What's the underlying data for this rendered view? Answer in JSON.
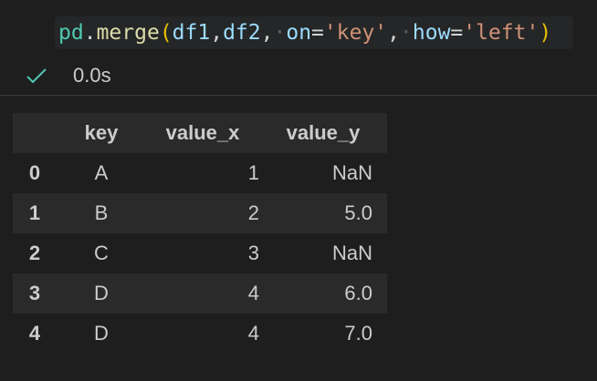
{
  "code": {
    "tokens": [
      {
        "t": "pd",
        "c": "tok-var"
      },
      {
        "t": ".",
        "c": "tok-op"
      },
      {
        "t": "merge",
        "c": "tok-fn"
      },
      {
        "t": "(",
        "c": "tok-paren"
      },
      {
        "t": "df1",
        "c": "tok-param"
      },
      {
        "t": ",",
        "c": "tok-op"
      },
      {
        "t": "df2",
        "c": "tok-param"
      },
      {
        "t": ",",
        "c": "tok-op"
      },
      {
        "t": "·",
        "c": "tok-ws"
      },
      {
        "t": "on",
        "c": "tok-param"
      },
      {
        "t": "=",
        "c": "tok-op"
      },
      {
        "t": "'key'",
        "c": "tok-str"
      },
      {
        "t": ",",
        "c": "tok-op"
      },
      {
        "t": "·",
        "c": "tok-ws"
      },
      {
        "t": "how",
        "c": "tok-param"
      },
      {
        "t": "=",
        "c": "tok-op"
      },
      {
        "t": "'left'",
        "c": "tok-str"
      },
      {
        "t": ")",
        "c": "tok-paren"
      }
    ]
  },
  "status": {
    "icon": "check-icon",
    "time": "0.0s",
    "color": "#4ec9b0"
  },
  "table": {
    "columns": [
      "",
      "key",
      "value_x",
      "value_y"
    ],
    "rows": [
      {
        "index": "0",
        "key": "A",
        "value_x": "1",
        "value_y": "NaN"
      },
      {
        "index": "1",
        "key": "B",
        "value_x": "2",
        "value_y": "5.0"
      },
      {
        "index": "2",
        "key": "C",
        "value_x": "3",
        "value_y": "NaN"
      },
      {
        "index": "3",
        "key": "D",
        "value_x": "4",
        "value_y": "6.0"
      },
      {
        "index": "4",
        "key": "D",
        "value_x": "4",
        "value_y": "7.0"
      }
    ]
  }
}
